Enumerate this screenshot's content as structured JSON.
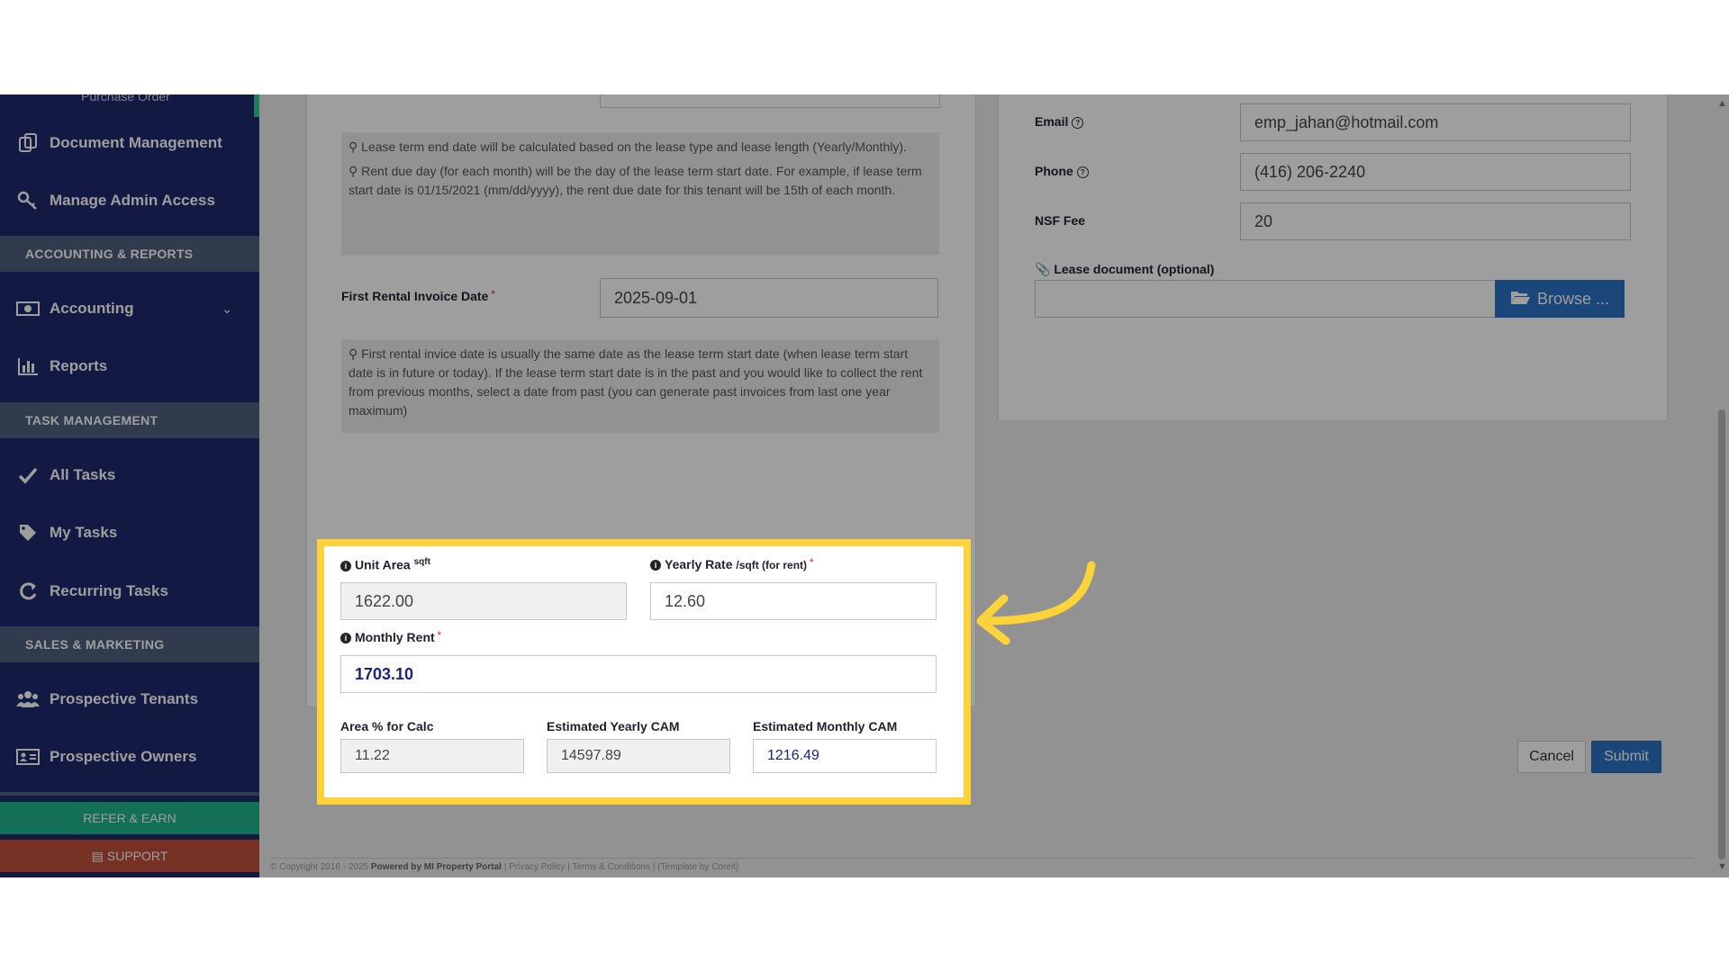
{
  "sidebar": {
    "top_item": "Purchase Order",
    "items": [
      {
        "label": "Document Management",
        "icon": "document-copy-icon"
      },
      {
        "label": "Manage Admin Access",
        "icon": "key-icon"
      },
      {
        "label": "Accounting",
        "icon": "money-icon"
      },
      {
        "label": "Reports",
        "icon": "bar-chart-icon"
      },
      {
        "label": "All Tasks",
        "icon": "check-icon"
      },
      {
        "label": "My Tasks",
        "icon": "tag-icon"
      },
      {
        "label": "Recurring Tasks",
        "icon": "refresh-icon"
      },
      {
        "label": "Prospective Tenants",
        "icon": "users-icon"
      },
      {
        "label": "Prospective Owners",
        "icon": "id-card-icon"
      }
    ],
    "sections": [
      "ACCOUNTING & REPORTS",
      "TASK MANAGEMENT",
      "SALES & MARKETING"
    ],
    "refer_label": "REFER & EARN",
    "support_label": "SUPPORT"
  },
  "lease": {
    "note1": "Lease term end date will be calculated based on the lease type and lease length (Yearly/Monthly).",
    "note2": "Rent due day (for each month) will be the day of the lease term start date. For example, if lease term start date is 01/15/2021 (mm/dd/yyyy), the rent due date for this tenant will be 15th of each month.",
    "first_invoice_label": "First Rental Invoice Date",
    "first_invoice_value": "2025-09-01",
    "note3": "First rental invice date is usually the same date as the lease term start date (when lease term start date is in future or today). If the lease term start date is in the past and you would like to collect the rent from previous months, select a date from past (you can generate past invoices from last one year maximum)",
    "required_mark": "*"
  },
  "rent": {
    "unit_area_label": "Unit Area",
    "unit_area_unit": "sqft",
    "unit_area_value": "1622.00",
    "yearly_rate_label": "Yearly Rate",
    "yearly_rate_unit": "/sqft (for rent)",
    "yearly_rate_value": "12.60",
    "monthly_rent_label": "Monthly Rent",
    "monthly_rent_value": "1703.10",
    "area_pct_label": "Area % for Calc",
    "area_pct_value": "11.22",
    "yearly_cam_label": "Estimated Yearly CAM",
    "yearly_cam_value": "14597.89",
    "monthly_cam_label": "Estimated Monthly CAM",
    "monthly_cam_value": "1216.49"
  },
  "contact": {
    "email_label": "Email",
    "email_value": "emp_jahan@hotmail.com",
    "phone_label": "Phone",
    "phone_value": "(416) 206-2240",
    "nsf_label": "NSF Fee",
    "nsf_value": "20",
    "lease_doc_label": "Lease document (optional)",
    "browse_label": "Browse ..."
  },
  "actions": {
    "cancel": "Cancel",
    "submit": "Submit"
  },
  "footer": {
    "copyright": "© Copyright 2016 - 2025",
    "powered": "Powered by MI Property Portal",
    "links": "| Privacy Policy | Terms & Conditions |",
    "template": "(Template by Coreit)"
  },
  "colors": {
    "highlight": "#fdd33a",
    "sidebar": "#1d2a6e",
    "primary": "#2a72c3",
    "bound_value": "#1a237e"
  }
}
